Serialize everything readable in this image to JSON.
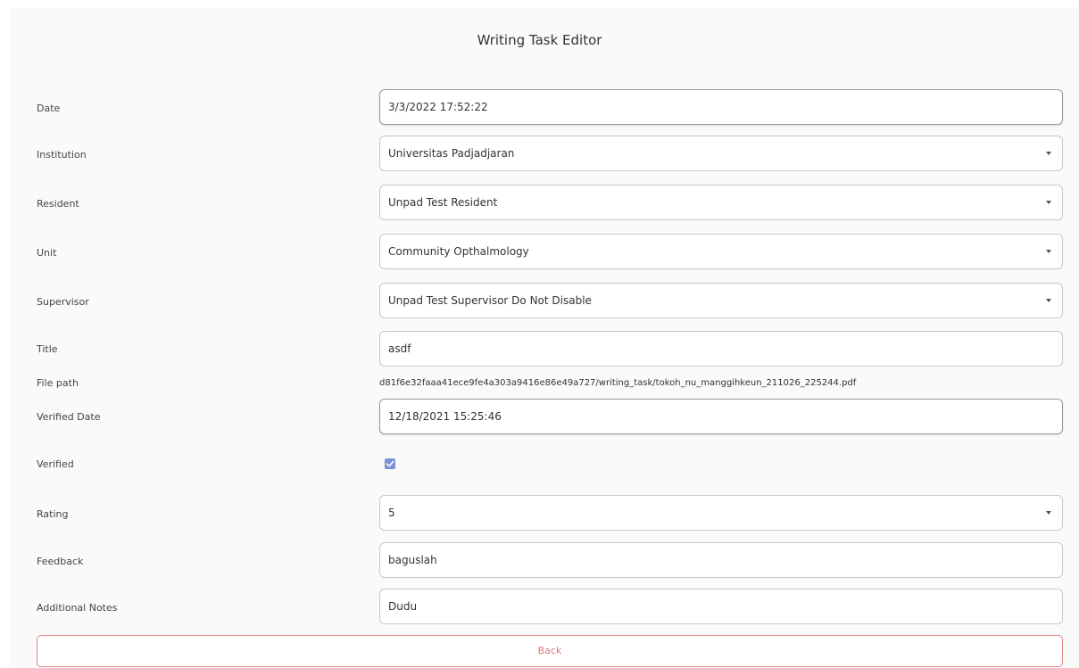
{
  "page": {
    "title": "Writing Task Editor"
  },
  "form": {
    "date": {
      "label": "Date",
      "value": "3/3/2022 17:52:22"
    },
    "institution": {
      "label": "Institution",
      "value": "Universitas Padjadjaran"
    },
    "resident": {
      "label": "Resident",
      "value": "Unpad Test Resident"
    },
    "unit": {
      "label": "Unit",
      "value": "Community Opthalmology"
    },
    "supervisor": {
      "label": "Supervisor",
      "value": "Unpad Test Supervisor Do Not Disable"
    },
    "title": {
      "label": "Title",
      "value": "asdf"
    },
    "file_path": {
      "label": "File path",
      "value": "d81f6e32faaa41ece9fe4a303a9416e86e49a727/writing_task/tokoh_nu_manggihkeun_211026_225244.pdf"
    },
    "verified_date": {
      "label": "Verified Date",
      "value": "12/18/2021 15:25:46"
    },
    "verified": {
      "label": "Verified",
      "checked": true
    },
    "rating": {
      "label": "Rating",
      "value": "5"
    },
    "feedback": {
      "label": "Feedback",
      "value": "baguslah"
    },
    "additional_notes": {
      "label": "Additional Notes",
      "value": "Dudu"
    }
  },
  "actions": {
    "back_label": "Back"
  },
  "colors": {
    "checkbox": "#7b93d6",
    "back_border": "#e08a8a",
    "back_text": "#e07a7a"
  }
}
